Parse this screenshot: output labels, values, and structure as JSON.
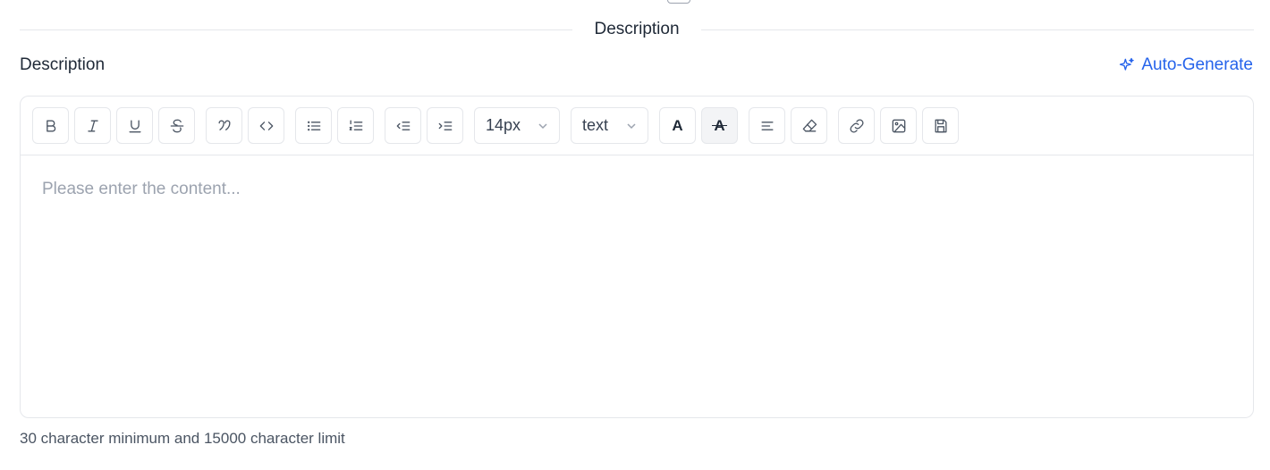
{
  "section": {
    "divider_label": "Description"
  },
  "field": {
    "label": "Description",
    "auto_generate_label": "Auto-Generate",
    "accent_color": "#2563eb"
  },
  "toolbar": {
    "buttons": [
      {
        "name": "bold",
        "icon": "bold-icon"
      },
      {
        "name": "italic",
        "icon": "italic-icon"
      },
      {
        "name": "underline",
        "icon": "underline-icon"
      },
      {
        "name": "strikethrough",
        "icon": "strikethrough-icon"
      },
      {
        "name": "blockquote",
        "icon": "quote-icon"
      },
      {
        "name": "code",
        "icon": "code-icon"
      },
      {
        "name": "bullet-list",
        "icon": "bullet-list-icon"
      },
      {
        "name": "ordered-list",
        "icon": "ordered-list-icon"
      },
      {
        "name": "outdent",
        "icon": "outdent-icon"
      },
      {
        "name": "indent",
        "icon": "indent-icon"
      },
      {
        "name": "font-color",
        "icon": "font-color-icon",
        "glyph": "A"
      },
      {
        "name": "font-background",
        "icon": "highlight-icon",
        "glyph": "A"
      },
      {
        "name": "align",
        "icon": "align-left-icon"
      },
      {
        "name": "clear-format",
        "icon": "eraser-icon"
      },
      {
        "name": "link",
        "icon": "link-icon"
      },
      {
        "name": "image",
        "icon": "image-icon"
      },
      {
        "name": "save",
        "icon": "save-icon"
      }
    ],
    "font_size": "14px",
    "text_type": "text"
  },
  "editor": {
    "placeholder": "Please enter the content..."
  },
  "hint": "30 character minimum and 15000 character limit"
}
